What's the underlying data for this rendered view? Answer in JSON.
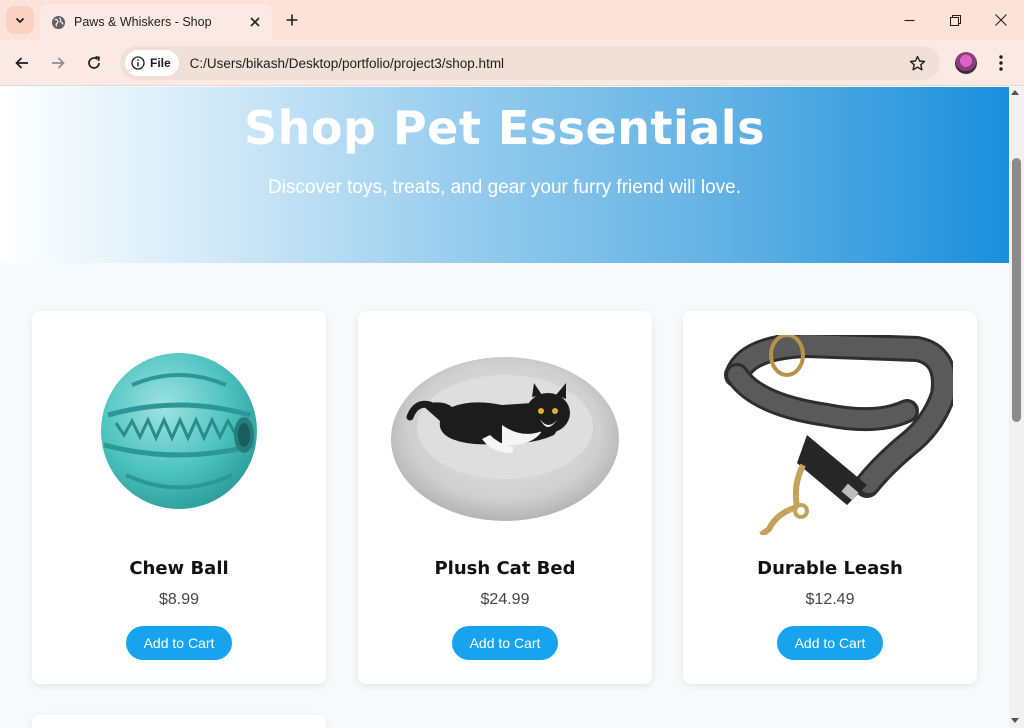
{
  "browser": {
    "tab_title": "Paws & Whiskers - Shop",
    "chip_label": "File",
    "url": "C:/Users/bikash/Desktop/portfolio/project3/shop.html"
  },
  "hero": {
    "title": "Shop Pet Essentials",
    "subtitle": "Discover toys, treats, and gear your furry friend will love."
  },
  "products": [
    {
      "name": "Chew Ball",
      "price": "$8.99",
      "button": "Add to Cart"
    },
    {
      "name": "Plush Cat Bed",
      "price": "$24.99",
      "button": "Add to Cart"
    },
    {
      "name": "Durable Leash",
      "price": "$12.49",
      "button": "Add to Cart"
    }
  ],
  "colors": {
    "accent": "#17a3ee",
    "hero_end": "#1a8fdd",
    "tab_bar": "#fde3d7"
  }
}
